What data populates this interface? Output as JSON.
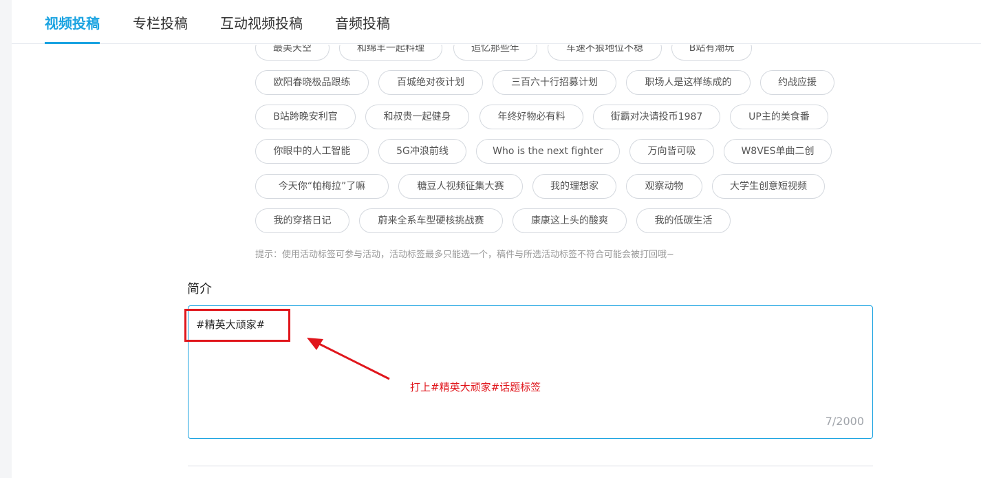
{
  "tabs": [
    {
      "label": "视频投稿",
      "active": true
    },
    {
      "label": "专栏投稿",
      "active": false
    },
    {
      "label": "互动视频投稿",
      "active": false
    },
    {
      "label": "音频投稿",
      "active": false
    }
  ],
  "tags": {
    "row0": [
      "最美天空",
      "和绵羊一起料理",
      "追忆那些年",
      "车速不狠地位不稳",
      "B站有潮玩"
    ],
    "row1": [
      "欧阳春晓极品跟练",
      "百城绝对夜计划",
      "三百六十行招募计划",
      "职场人是这样练成的",
      "约战应援"
    ],
    "row2": [
      "B站跨晚安利官",
      "和叔贵一起健身",
      "年终好物必有料",
      "街霸对决请投币1987",
      "UP主的美食番"
    ],
    "row3": [
      "你眼中的人工智能",
      "5G冲浪前线",
      "Who is the next fighter",
      "万向皆可吸",
      "W8VES单曲二创"
    ],
    "row4": [
      "今天你“帕梅拉”了嘛",
      "糖豆人视频征集大赛",
      "我的理想家",
      "观察动物",
      "大学生创意短视频"
    ],
    "row5": [
      "我的穿搭日记",
      "蔚来全系车型硬核挑战赛",
      "康康这上头的酸爽",
      "我的低碳生活"
    ]
  },
  "hint": "提示：使用活动标签可参与活动，活动标签最多只能选一个，稿件与所选活动标签不符合可能会被打回哦~",
  "intro": {
    "label": "简介",
    "value": "#精英大顽家#",
    "counter": "7/2000"
  },
  "annotation": {
    "text": "打上#精英大顽家#话题标签",
    "color": "#e0161c"
  },
  "colors": {
    "accent": "#1aa3e1",
    "annotation": "#e0161c"
  }
}
